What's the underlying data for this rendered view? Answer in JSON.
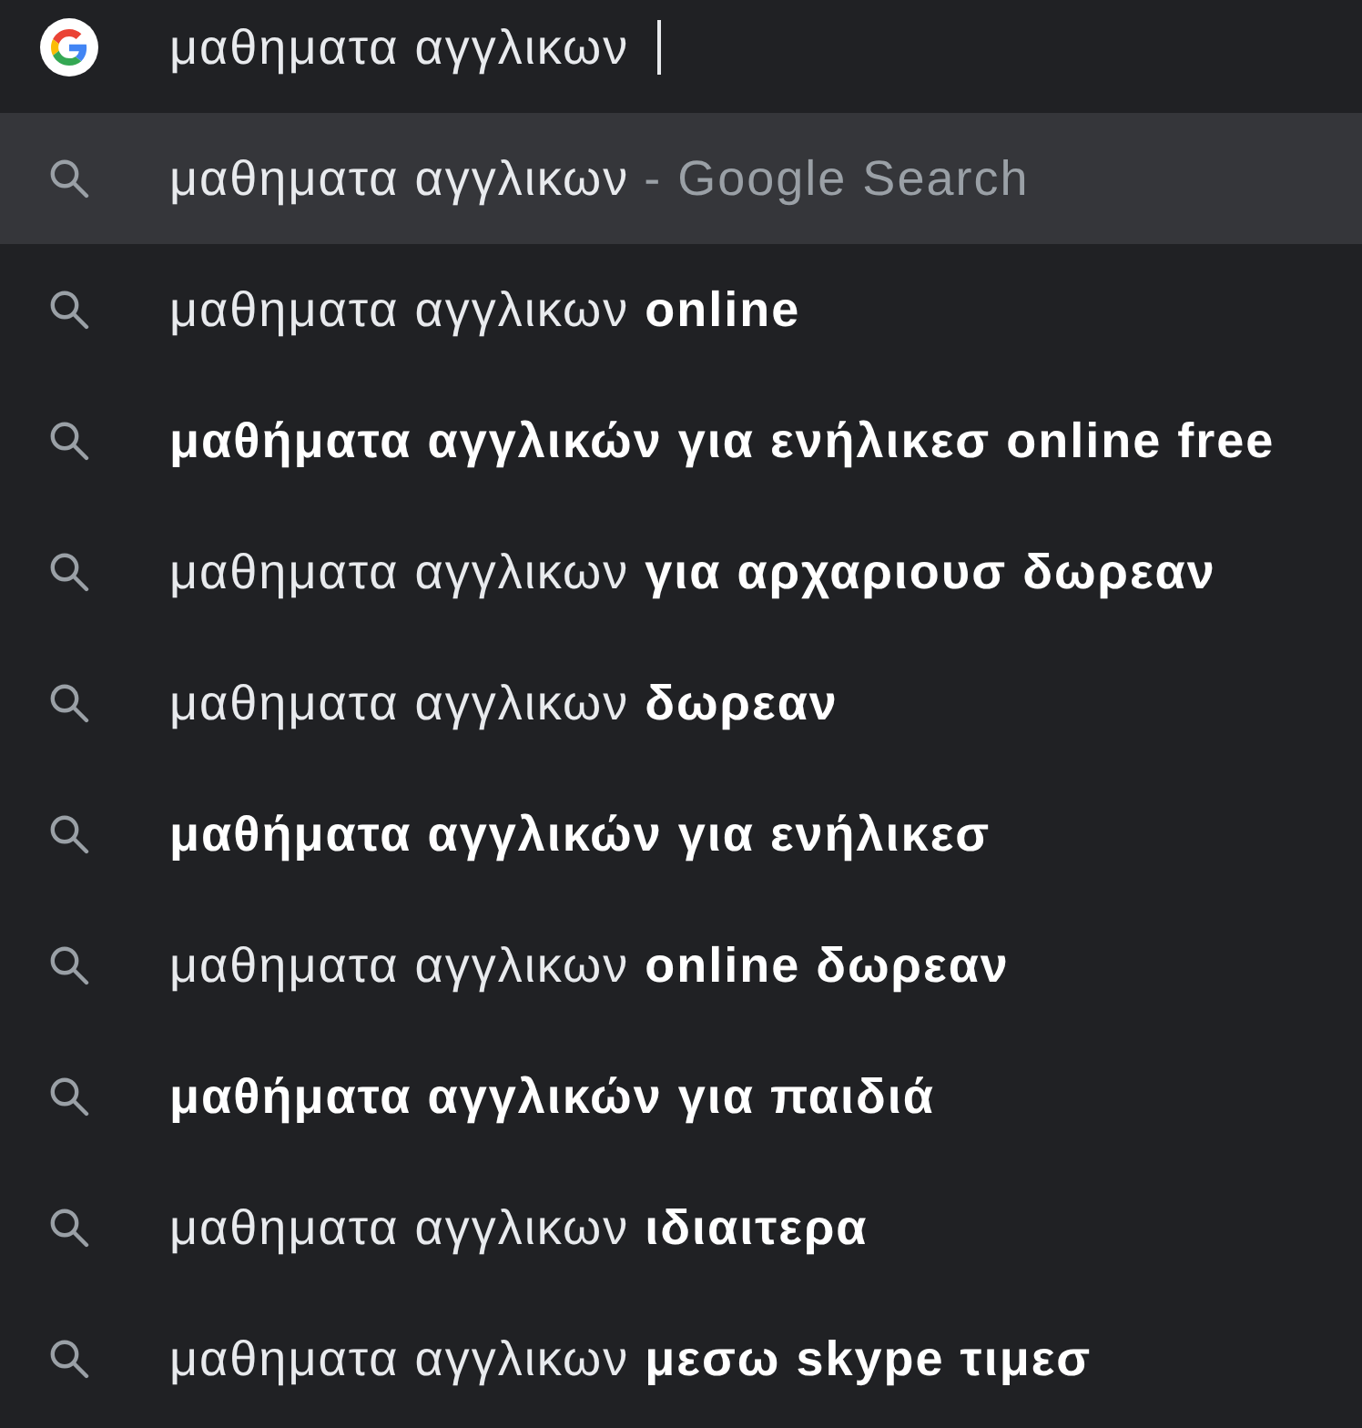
{
  "search_box": {
    "value": "μαθηματα αγγλικων",
    "focused": true
  },
  "suggestions": [
    {
      "text": "μαθηματα αγγλικων",
      "suffix": "- Google Search",
      "bold": false,
      "selected": true
    },
    {
      "text": "μαθηματα αγγλικων **online**",
      "bold": false,
      "selected": false
    },
    {
      "text": "μαθήματα αγγλικών για ενήλικεσ online free",
      "bold": true,
      "selected": false
    },
    {
      "text": "μαθηματα αγγλικων **για αρχαριουσ δωρεαν**",
      "bold": false,
      "selected": false
    },
    {
      "text": "μαθηματα αγγλικων **δωρεαν**",
      "bold": false,
      "selected": false
    },
    {
      "text": "μαθήματα αγγλικών για ενήλικεσ",
      "bold": true,
      "selected": false
    },
    {
      "text": "μαθηματα αγγλικων **online δωρεαν**",
      "bold": false,
      "selected": false
    },
    {
      "text": "μαθήματα αγγλικών για παιδιά",
      "bold": true,
      "selected": false
    },
    {
      "text": "μαθηματα αγγλικων **ιδιαιτερα**",
      "bold": false,
      "selected": false
    },
    {
      "text": "μαθηματα αγγλικων **μεσω skype τιμεσ**",
      "bold": false,
      "selected": false
    }
  ]
}
